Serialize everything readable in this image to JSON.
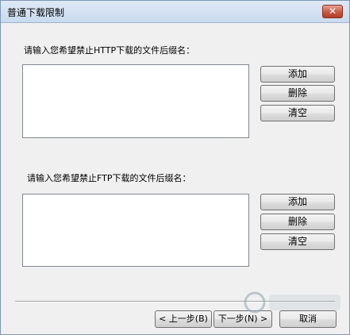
{
  "window": {
    "title": "普通下载限制",
    "close_glyph": "✕"
  },
  "http_section": {
    "label": "请输入您希望禁止HTTP下载的文件后缀名：",
    "items": [],
    "add_label": "添加",
    "delete_label": "删除",
    "clear_label": "清空"
  },
  "ftp_section": {
    "label": "请输入您希望禁止FTP下载的文件后缀名：",
    "items": [],
    "add_label": "添加",
    "delete_label": "删除",
    "clear_label": "清空"
  },
  "footer": {
    "back_label": "< 上一步(B)",
    "next_label": "下一步(N) >",
    "cancel_label": "取消"
  }
}
